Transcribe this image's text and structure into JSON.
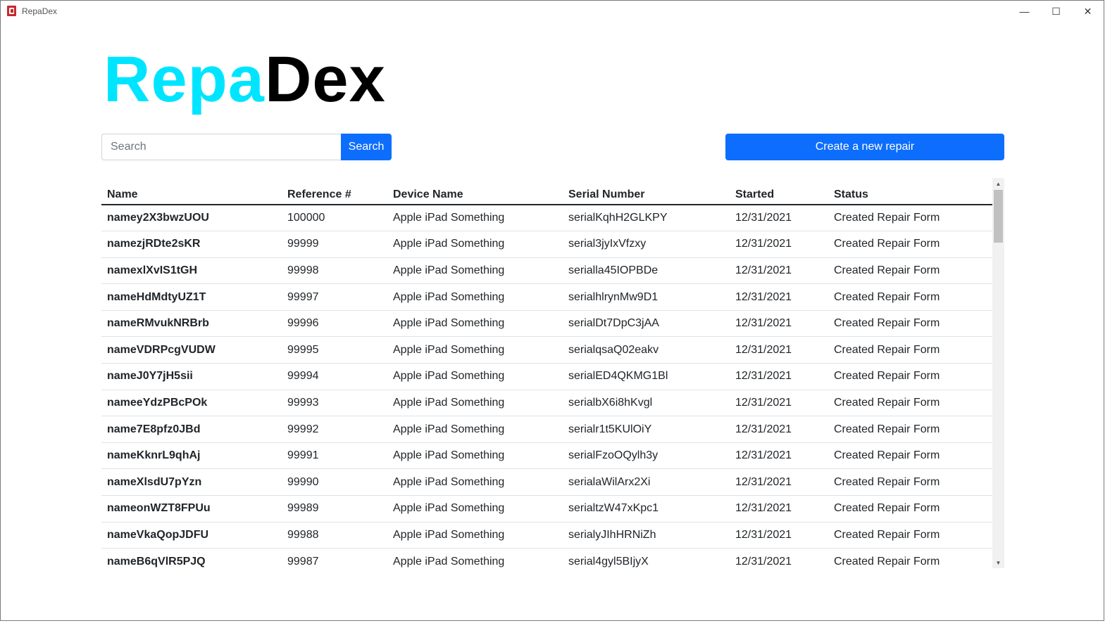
{
  "window": {
    "title": "RepaDex",
    "minimize": "—",
    "maximize": "☐",
    "close": "✕"
  },
  "logo": {
    "part1": "Repa",
    "part2": "Dex",
    "colors": {
      "part1": "#00e5ff",
      "part2": "#000000"
    }
  },
  "search": {
    "placeholder": "Search",
    "value": "",
    "button_label": "Search"
  },
  "create_button_label": "Create a new repair",
  "accent_color": "#0d6efd",
  "table": {
    "headers": [
      "Name",
      "Reference #",
      "Device Name",
      "Serial Number",
      "Started",
      "Status"
    ],
    "rows": [
      [
        "namey2X3bwzUOU",
        "100000",
        "Apple iPad Something",
        "serialKqhH2GLKPY",
        "12/31/2021",
        "Created Repair Form"
      ],
      [
        "namezjRDte2sKR",
        "99999",
        "Apple iPad Something",
        "serial3jyIxVfzxy",
        "12/31/2021",
        "Created Repair Form"
      ],
      [
        "namexlXvIS1tGH",
        "99998",
        "Apple iPad Something",
        "serialla45IOPBDe",
        "12/31/2021",
        "Created Repair Form"
      ],
      [
        "nameHdMdtyUZ1T",
        "99997",
        "Apple iPad Something",
        "serialhlrynMw9D1",
        "12/31/2021",
        "Created Repair Form"
      ],
      [
        "nameRMvukNRBrb",
        "99996",
        "Apple iPad Something",
        "serialDt7DpC3jAA",
        "12/31/2021",
        "Created Repair Form"
      ],
      [
        "nameVDRPcgVUDW",
        "99995",
        "Apple iPad Something",
        "serialqsaQ02eakv",
        "12/31/2021",
        "Created Repair Form"
      ],
      [
        "nameJ0Y7jH5sii",
        "99994",
        "Apple iPad Something",
        "serialED4QKMG1Bl",
        "12/31/2021",
        "Created Repair Form"
      ],
      [
        "nameeYdzPBcPOk",
        "99993",
        "Apple iPad Something",
        "serialbX6i8hKvgl",
        "12/31/2021",
        "Created Repair Form"
      ],
      [
        "name7E8pfz0JBd",
        "99992",
        "Apple iPad Something",
        "serialr1t5KUlOiY",
        "12/31/2021",
        "Created Repair Form"
      ],
      [
        "nameKknrL9qhAj",
        "99991",
        "Apple iPad Something",
        "serialFzoOQylh3y",
        "12/31/2021",
        "Created Repair Form"
      ],
      [
        "nameXlsdU7pYzn",
        "99990",
        "Apple iPad Something",
        "serialaWilArx2Xi",
        "12/31/2021",
        "Created Repair Form"
      ],
      [
        "nameonWZT8FPUu",
        "99989",
        "Apple iPad Something",
        "serialtzW47xKpc1",
        "12/31/2021",
        "Created Repair Form"
      ],
      [
        "nameVkaQopJDFU",
        "99988",
        "Apple iPad Something",
        "serialyJIhHRNiZh",
        "12/31/2021",
        "Created Repair Form"
      ],
      [
        "nameB6qVlR5PJQ",
        "99987",
        "Apple iPad Something",
        "serial4gyl5BIjyX",
        "12/31/2021",
        "Created Repair Form"
      ]
    ]
  }
}
